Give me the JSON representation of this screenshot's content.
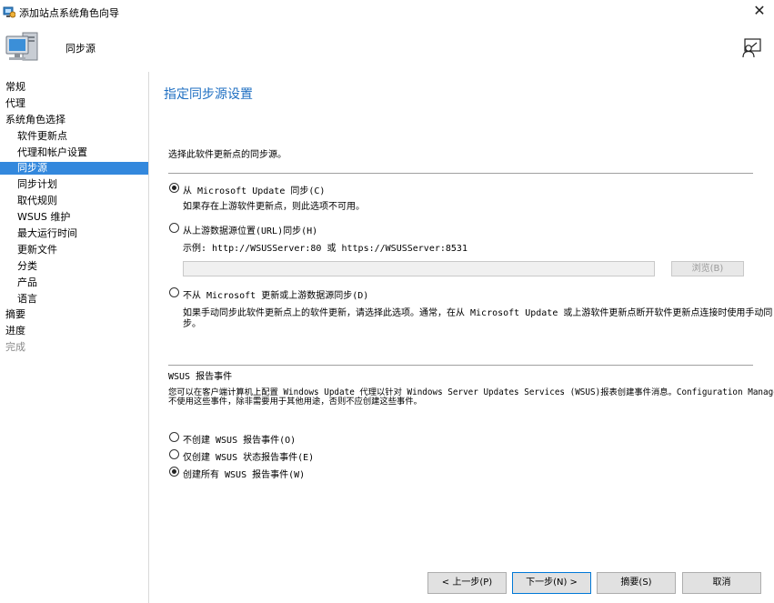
{
  "window": {
    "title": "添加站点系统角色向导"
  },
  "banner": {
    "title": "同步源"
  },
  "sidebar": {
    "items": [
      {
        "label": "常规"
      },
      {
        "label": "代理"
      },
      {
        "label": "系统角色选择"
      },
      {
        "label": "软件更新点"
      },
      {
        "label": "代理和帐户设置"
      },
      {
        "label": "同步源"
      },
      {
        "label": "同步计划"
      },
      {
        "label": "取代规则"
      },
      {
        "label": "WSUS 维护"
      },
      {
        "label": "最大运行时间"
      },
      {
        "label": "更新文件"
      },
      {
        "label": "分类"
      },
      {
        "label": "产品"
      },
      {
        "label": "语言"
      },
      {
        "label": "摘要"
      },
      {
        "label": "进度"
      },
      {
        "label": "完成"
      }
    ]
  },
  "main": {
    "heading": "指定同步源设置",
    "intro": "选择此软件更新点的同步源。",
    "options": [
      {
        "label": "从 Microsoft Update 同步(C)",
        "selected": true,
        "note": "如果存在上游软件更新点，则此选项不可用。"
      },
      {
        "label": "从上游数据源位置(URL)同步(H)",
        "selected": false,
        "note": "示例: http://WSUSServer:80 或 https://WSUSServer:8531"
      },
      {
        "label": "不从 Microsoft 更新或上游数据源同步(D)",
        "selected": false,
        "note_line1": "如果手动同步此软件更新点上的软件更新，请选择此选项。通常，在从 Microsoft Update 或上游软件更新点断开软件更新点连接时使用手动同",
        "note_line2": "步。"
      }
    ],
    "url_value": "",
    "browse_label": "浏览(B)",
    "wsus_title": "WSUS 报告事件",
    "wsus_desc_line1": "您可以在客户端计算机上配置 Windows Update 代理以针对 Windows Server Updates Services (WSUS)报表创建事件消息。Configuration Manager",
    "wsus_desc_line2": "不使用这些事件，除非需要用于其他用途，否则不应创建这些事件。",
    "wsus_options": [
      {
        "label": "不创建 WSUS 报告事件(O)",
        "selected": false
      },
      {
        "label": "仅创建 WSUS 状态报告事件(E)",
        "selected": false
      },
      {
        "label": "创建所有 WSUS 报告事件(W)",
        "selected": true
      }
    ]
  },
  "footer": {
    "prev": "< 上一步(P)",
    "next": "下一步(N) >",
    "summary": "摘要(S)",
    "cancel": "取消"
  },
  "colors": {
    "accent": "#3388dd",
    "heading": "#1f6fc2"
  }
}
